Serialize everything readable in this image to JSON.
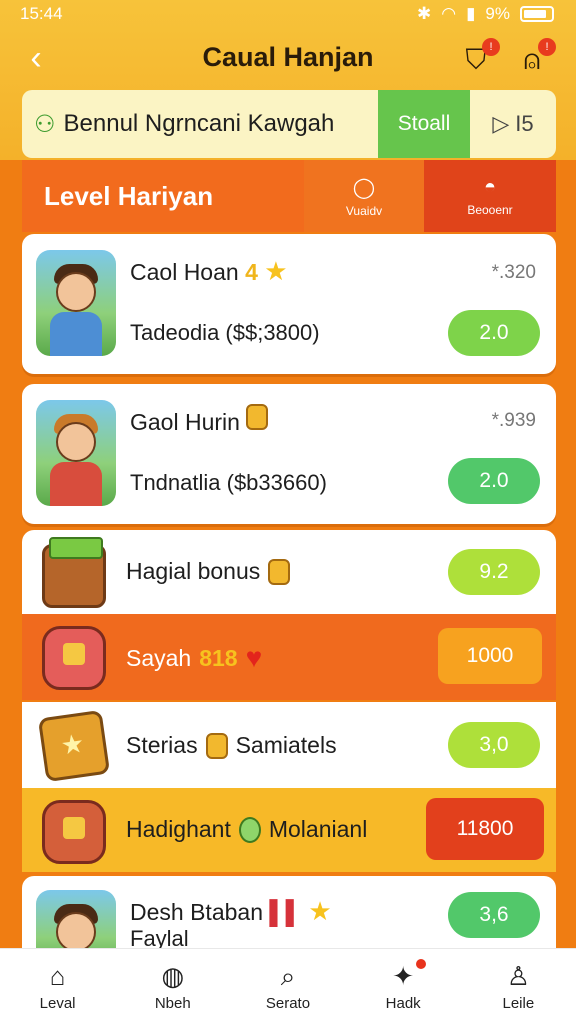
{
  "status": {
    "time": "15:44",
    "battery": "9%"
  },
  "header": {
    "title": "Caual Hanjan",
    "back_icon": "chevron-left-icon"
  },
  "banner": {
    "text": "Bennul Ngrncani Kawgah",
    "button": "Stoall",
    "play_count": "I5"
  },
  "levelbar": {
    "title": "Level Hariyan",
    "tab1": "Vuaidv",
    "tab2": "Beooenr"
  },
  "cards": [
    {
      "name": "Caol Hoan",
      "badge": "4",
      "metric": "*.320",
      "sub": "Tadeodia ($$;3800)",
      "pill": "2.0"
    },
    {
      "name": "Gaol Hurin",
      "metric": "*.939",
      "sub": "Tndnatlia ($b33660)",
      "pill": "2.0"
    },
    {
      "name": "Hagial bonus",
      "pill": "9.2"
    },
    {
      "name": "Sayah",
      "num": "818",
      "pill": "1000"
    },
    {
      "name": "Sterias",
      "name2": "Samiatels",
      "pill": "3,0"
    },
    {
      "name": "Hadighant",
      "name2": "Molanianl",
      "pill": "11800"
    },
    {
      "name": "Desh Btaban",
      "name2": "Faylal",
      "pill": "3,6"
    }
  ],
  "nav": [
    {
      "label": "Leval",
      "icon": "home-icon"
    },
    {
      "label": "Nbeh",
      "icon": "rocket-icon"
    },
    {
      "label": "Serato",
      "icon": "search-icon"
    },
    {
      "label": "Hadk",
      "icon": "gamepad-icon"
    },
    {
      "label": "Leile",
      "icon": "user-icon"
    }
  ],
  "colors": {
    "bg": "#f07d12",
    "green": "#66c54c",
    "accent": "#e2401c"
  }
}
